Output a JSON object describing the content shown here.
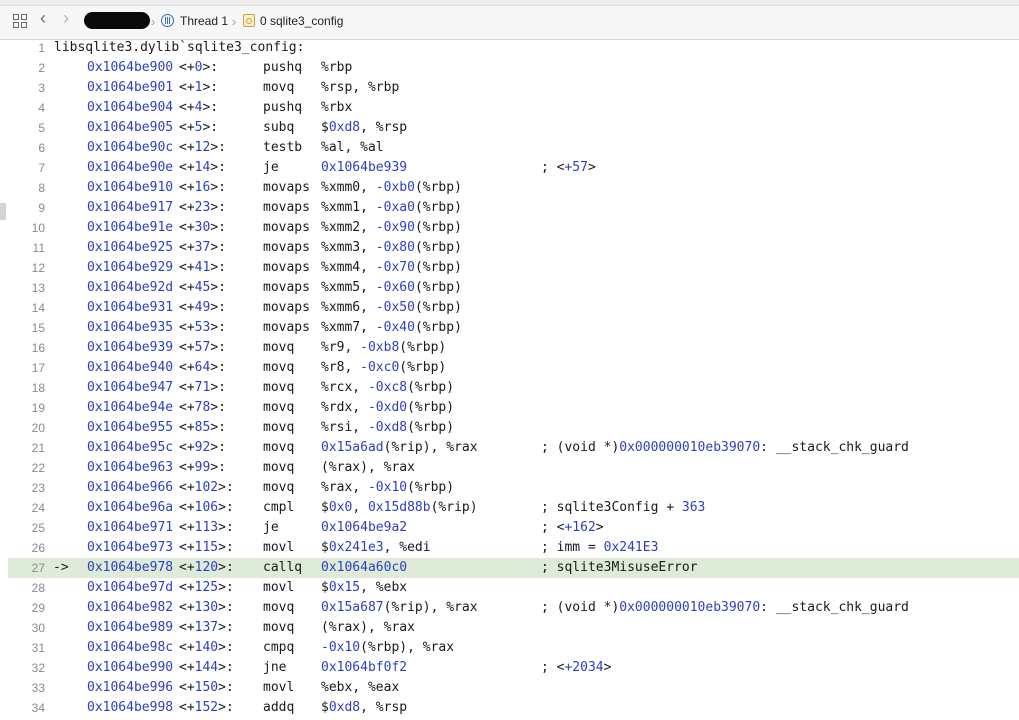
{
  "jumpbar": {
    "thread_label": "Thread 1",
    "frame_label": "0 sqlite3_config"
  },
  "code": {
    "header": "libsqlite3.dylib`sqlite3_config:",
    "lines": [
      {
        "n": "1",
        "header": true
      },
      {
        "n": "2",
        "addr": "0x1064be900",
        "pre": "<+",
        "off": "0",
        "post": ">:",
        "mn": "pushq",
        "ops": [
          [
            "%rbp",
            0
          ]
        ],
        "cm": []
      },
      {
        "n": "3",
        "addr": "0x1064be901",
        "pre": "<+",
        "off": "1",
        "post": ">:",
        "mn": "movq",
        "ops": [
          [
            "%rsp, %rbp",
            0
          ]
        ],
        "cm": []
      },
      {
        "n": "4",
        "addr": "0x1064be904",
        "pre": "<+",
        "off": "4",
        "post": ">:",
        "mn": "pushq",
        "ops": [
          [
            "%rbx",
            0
          ]
        ],
        "cm": []
      },
      {
        "n": "5",
        "addr": "0x1064be905",
        "pre": "<+",
        "off": "5",
        "post": ">:",
        "mn": "subq",
        "ops": [
          [
            "$",
            0
          ],
          [
            "0xd8",
            1
          ],
          [
            ", %rsp",
            0
          ]
        ],
        "cm": []
      },
      {
        "n": "6",
        "addr": "0x1064be90c",
        "pre": "<+",
        "off": "12",
        "post": ">:",
        "mn": "testb",
        "ops": [
          [
            "%al, %al",
            0
          ]
        ],
        "cm": []
      },
      {
        "n": "7",
        "addr": "0x1064be90e",
        "pre": "<+",
        "off": "14",
        "post": ">:",
        "mn": "je",
        "ops": [
          [
            "0x1064be939",
            1
          ]
        ],
        "cm": [
          [
            "; <",
            0
          ],
          [
            "+57",
            1
          ],
          [
            ">",
            0
          ]
        ]
      },
      {
        "n": "8",
        "addr": "0x1064be910",
        "pre": "<+",
        "off": "16",
        "post": ">:",
        "mn": "movaps",
        "ops": [
          [
            "%xmm0, ",
            0
          ],
          [
            "-0xb0",
            1
          ],
          [
            "(%rbp)",
            0
          ]
        ],
        "cm": []
      },
      {
        "n": "9",
        "addr": "0x1064be917",
        "pre": "<+",
        "off": "23",
        "post": ">:",
        "mn": "movaps",
        "ops": [
          [
            "%xmm1, ",
            0
          ],
          [
            "-0xa0",
            1
          ],
          [
            "(%rbp)",
            0
          ]
        ],
        "cm": []
      },
      {
        "n": "10",
        "addr": "0x1064be91e",
        "pre": "<+",
        "off": "30",
        "post": ">:",
        "mn": "movaps",
        "ops": [
          [
            "%xmm2, ",
            0
          ],
          [
            "-0x90",
            1
          ],
          [
            "(%rbp)",
            0
          ]
        ],
        "cm": []
      },
      {
        "n": "11",
        "addr": "0x1064be925",
        "pre": "<+",
        "off": "37",
        "post": ">:",
        "mn": "movaps",
        "ops": [
          [
            "%xmm3, ",
            0
          ],
          [
            "-0x80",
            1
          ],
          [
            "(%rbp)",
            0
          ]
        ],
        "cm": []
      },
      {
        "n": "12",
        "addr": "0x1064be929",
        "pre": "<+",
        "off": "41",
        "post": ">:",
        "mn": "movaps",
        "ops": [
          [
            "%xmm4, ",
            0
          ],
          [
            "-0x70",
            1
          ],
          [
            "(%rbp)",
            0
          ]
        ],
        "cm": []
      },
      {
        "n": "13",
        "addr": "0x1064be92d",
        "pre": "<+",
        "off": "45",
        "post": ">:",
        "mn": "movaps",
        "ops": [
          [
            "%xmm5, ",
            0
          ],
          [
            "-0x60",
            1
          ],
          [
            "(%rbp)",
            0
          ]
        ],
        "cm": []
      },
      {
        "n": "14",
        "addr": "0x1064be931",
        "pre": "<+",
        "off": "49",
        "post": ">:",
        "mn": "movaps",
        "ops": [
          [
            "%xmm6, ",
            0
          ],
          [
            "-0x50",
            1
          ],
          [
            "(%rbp)",
            0
          ]
        ],
        "cm": []
      },
      {
        "n": "15",
        "addr": "0x1064be935",
        "pre": "<+",
        "off": "53",
        "post": ">:",
        "mn": "movaps",
        "ops": [
          [
            "%xmm7, ",
            0
          ],
          [
            "-0x40",
            1
          ],
          [
            "(%rbp)",
            0
          ]
        ],
        "cm": []
      },
      {
        "n": "16",
        "addr": "0x1064be939",
        "pre": "<+",
        "off": "57",
        "post": ">:",
        "mn": "movq",
        "ops": [
          [
            "%r9, ",
            0
          ],
          [
            "-0xb8",
            1
          ],
          [
            "(%rbp)",
            0
          ]
        ],
        "cm": []
      },
      {
        "n": "17",
        "addr": "0x1064be940",
        "pre": "<+",
        "off": "64",
        "post": ">:",
        "mn": "movq",
        "ops": [
          [
            "%r8, ",
            0
          ],
          [
            "-0xc0",
            1
          ],
          [
            "(%rbp)",
            0
          ]
        ],
        "cm": []
      },
      {
        "n": "18",
        "addr": "0x1064be947",
        "pre": "<+",
        "off": "71",
        "post": ">:",
        "mn": "movq",
        "ops": [
          [
            "%rcx, ",
            0
          ],
          [
            "-0xc8",
            1
          ],
          [
            "(%rbp)",
            0
          ]
        ],
        "cm": []
      },
      {
        "n": "19",
        "addr": "0x1064be94e",
        "pre": "<+",
        "off": "78",
        "post": ">:",
        "mn": "movq",
        "ops": [
          [
            "%rdx, ",
            0
          ],
          [
            "-0xd0",
            1
          ],
          [
            "(%rbp)",
            0
          ]
        ],
        "cm": []
      },
      {
        "n": "20",
        "addr": "0x1064be955",
        "pre": "<+",
        "off": "85",
        "post": ">:",
        "mn": "movq",
        "ops": [
          [
            "%rsi, ",
            0
          ],
          [
            "-0xd8",
            1
          ],
          [
            "(%rbp)",
            0
          ]
        ],
        "cm": []
      },
      {
        "n": "21",
        "addr": "0x1064be95c",
        "pre": "<+",
        "off": "92",
        "post": ">:",
        "mn": "movq",
        "ops": [
          [
            "0x15a6ad",
            1
          ],
          [
            "(%rip), %rax",
            0
          ]
        ],
        "cm": [
          [
            "; (void *)",
            0
          ],
          [
            "0x000000010eb39070",
            1
          ],
          [
            ": __stack_chk_guard",
            0
          ]
        ]
      },
      {
        "n": "22",
        "addr": "0x1064be963",
        "pre": "<+",
        "off": "99",
        "post": ">:",
        "mn": "movq",
        "ops": [
          [
            "(%rax), %rax",
            0
          ]
        ],
        "cm": []
      },
      {
        "n": "23",
        "addr": "0x1064be966",
        "pre": "<+",
        "off": "102",
        "post": ">:",
        "mn": "movq",
        "ops": [
          [
            "%rax, ",
            0
          ],
          [
            "-0x10",
            1
          ],
          [
            "(%rbp)",
            0
          ]
        ],
        "cm": []
      },
      {
        "n": "24",
        "addr": "0x1064be96a",
        "pre": "<+",
        "off": "106",
        "post": ">:",
        "mn": "cmpl",
        "ops": [
          [
            "$",
            0
          ],
          [
            "0x0",
            1
          ],
          [
            ", ",
            0
          ],
          [
            "0x15d88b",
            1
          ],
          [
            "(%rip)",
            0
          ]
        ],
        "cm": [
          [
            "; sqlite3Config + ",
            0
          ],
          [
            "363",
            1
          ]
        ]
      },
      {
        "n": "25",
        "addr": "0x1064be971",
        "pre": "<+",
        "off": "113",
        "post": ">:",
        "mn": "je",
        "ops": [
          [
            "0x1064be9a2",
            1
          ]
        ],
        "cm": [
          [
            "; <",
            0
          ],
          [
            "+162",
            1
          ],
          [
            ">",
            0
          ]
        ]
      },
      {
        "n": "26",
        "addr": "0x1064be973",
        "pre": "<+",
        "off": "115",
        "post": ">:",
        "mn": "movl",
        "ops": [
          [
            "$",
            0
          ],
          [
            "0x241e3",
            1
          ],
          [
            ", %edi",
            0
          ]
        ],
        "cm": [
          [
            "; imm = ",
            0
          ],
          [
            "0x241E3",
            1
          ]
        ]
      },
      {
        "n": "27",
        "current": true,
        "arrow": "->",
        "addr": "0x1064be978",
        "pre": "<+",
        "off": "120",
        "post": ">:",
        "mn": "callq",
        "ops": [
          [
            "0x1064a60c0",
            1
          ]
        ],
        "cm": [
          [
            "; sqlite3MisuseError",
            0
          ]
        ]
      },
      {
        "n": "28",
        "addr": "0x1064be97d",
        "pre": "<+",
        "off": "125",
        "post": ">:",
        "mn": "movl",
        "ops": [
          [
            "$",
            0
          ],
          [
            "0x15",
            1
          ],
          [
            ", %ebx",
            0
          ]
        ],
        "cm": []
      },
      {
        "n": "29",
        "addr": "0x1064be982",
        "pre": "<+",
        "off": "130",
        "post": ">:",
        "mn": "movq",
        "ops": [
          [
            "0x15a687",
            1
          ],
          [
            "(%rip), %rax",
            0
          ]
        ],
        "cm": [
          [
            "; (void *)",
            0
          ],
          [
            "0x000000010eb39070",
            1
          ],
          [
            ": __stack_chk_guard",
            0
          ]
        ]
      },
      {
        "n": "30",
        "addr": "0x1064be989",
        "pre": "<+",
        "off": "137",
        "post": ">:",
        "mn": "movq",
        "ops": [
          [
            "(%rax), %rax",
            0
          ]
        ],
        "cm": []
      },
      {
        "n": "31",
        "addr": "0x1064be98c",
        "pre": "<+",
        "off": "140",
        "post": ">:",
        "mn": "cmpq",
        "ops": [
          [
            "-0x10",
            1
          ],
          [
            "(%rbp), %rax",
            0
          ]
        ],
        "cm": []
      },
      {
        "n": "32",
        "addr": "0x1064be990",
        "pre": "<+",
        "off": "144",
        "post": ">:",
        "mn": "jne",
        "ops": [
          [
            "0x1064bf0f2",
            1
          ]
        ],
        "cm": [
          [
            "; <",
            0
          ],
          [
            "+2034",
            1
          ],
          [
            ">",
            0
          ]
        ]
      },
      {
        "n": "33",
        "addr": "0x1064be996",
        "pre": "<+",
        "off": "150",
        "post": ">:",
        "mn": "movl",
        "ops": [
          [
            "%ebx, %eax",
            0
          ]
        ],
        "cm": []
      },
      {
        "n": "34",
        "addr": "0x1064be998",
        "pre": "<+",
        "off": "152",
        "post": ">:",
        "mn": "addq",
        "ops": [
          [
            "$",
            0
          ],
          [
            "0xd8",
            1
          ],
          [
            ", %rsp",
            0
          ]
        ],
        "cm": []
      }
    ]
  }
}
